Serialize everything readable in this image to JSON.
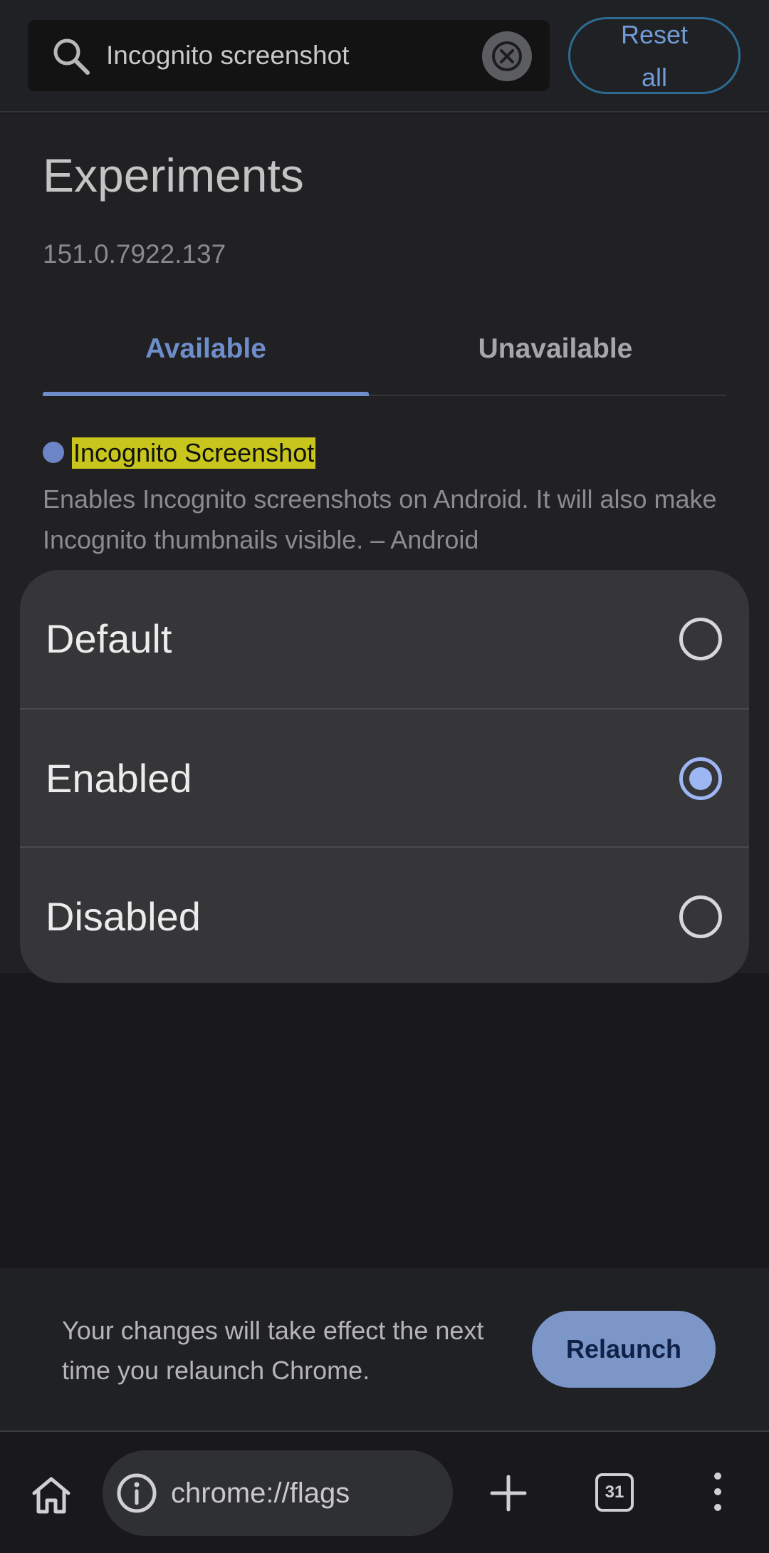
{
  "search": {
    "value": "Incognito screenshot",
    "reset_label": "Reset all"
  },
  "main": {
    "title": "Experiments",
    "version": "151.0.7922.137",
    "tabs": [
      {
        "label": "Available",
        "active": true
      },
      {
        "label": "Unavailable",
        "active": false
      }
    ],
    "flag": {
      "name": "Incognito Screenshot",
      "description": "Enables Incognito screenshots on Android. It will also make Incognito thumbnails visible. – Android"
    }
  },
  "popup": {
    "options": [
      {
        "label": "Default",
        "selected": false
      },
      {
        "label": "Enabled",
        "selected": true
      },
      {
        "label": "Disabled",
        "selected": false
      }
    ]
  },
  "relaunch": {
    "message": "Your changes will take effect the next time you relaunch Chrome.",
    "button_label": "Relaunch"
  },
  "toolbar": {
    "url": "chrome://flags",
    "tab_count": "31",
    "icons": [
      "home-icon",
      "info-icon",
      "plus-icon",
      "tab-switcher-icon",
      "more-vert-icon"
    ]
  },
  "colors": {
    "accent": "#6e8ecb",
    "highlight": "#c8c51d",
    "radio_selected": "#9db6f4",
    "relaunch_button": "#7c96c7"
  }
}
